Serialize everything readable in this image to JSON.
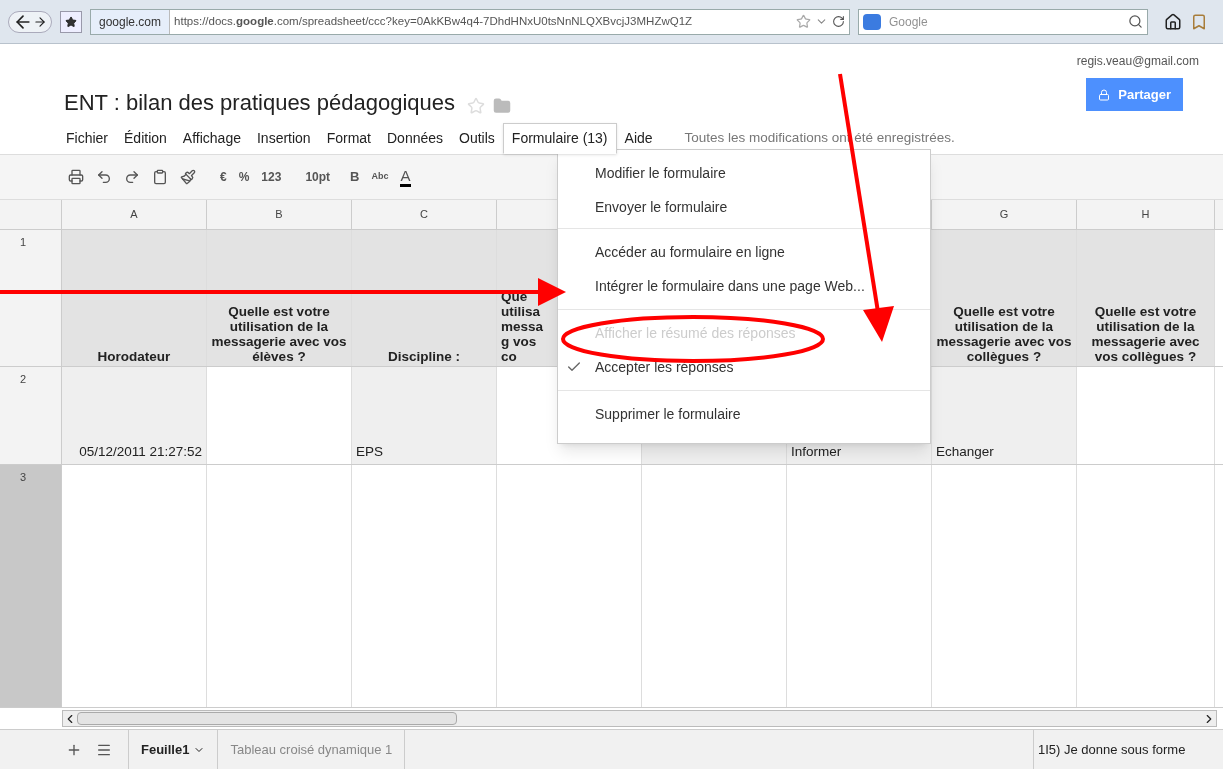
{
  "browser": {
    "site_badge": "google.com",
    "url": "https://docs.**google**.com/spreadsheet/ccc?key=0AkKBw4q4-7DhdHNxU0tsNnNLQXBvcjJ3MHZwQ1Z",
    "search": {
      "placeholder": "Google"
    }
  },
  "account": "regis.veau@gmail.com",
  "share_button": "Partager",
  "title": "ENT : bilan des pratiques pédagogiques",
  "menu": [
    {
      "label": "Fichier",
      "selected": false
    },
    {
      "label": "Édition",
      "selected": false
    },
    {
      "label": "Affichage",
      "selected": false
    },
    {
      "label": "Insertion",
      "selected": false
    },
    {
      "label": "Format",
      "selected": false
    },
    {
      "label": "Données",
      "selected": false
    },
    {
      "label": "Outils",
      "selected": false
    },
    {
      "label": "Formulaire (13)",
      "selected": true
    },
    {
      "label": "Aide",
      "selected": false
    }
  ],
  "save_status": "Toutes les modifications ont été enregistrées.",
  "toolbar": {
    "currency": "€",
    "percent": "%",
    "number_format": "123",
    "font_size": "10pt",
    "bold": "B",
    "spellcheck": "Abc",
    "text_color": "A"
  },
  "dropdown": [
    [
      {
        "label": "Modifier le formulaire",
        "disabled": false,
        "checked": false
      },
      {
        "label": "Envoyer le formulaire",
        "disabled": false,
        "checked": false
      }
    ],
    [
      {
        "label": "Accéder au formulaire en ligne",
        "disabled": false,
        "checked": false
      },
      {
        "label": "Intégrer le formulaire dans une page Web...",
        "disabled": false,
        "checked": false
      }
    ],
    [
      {
        "label": "Afficher le résumé des réponses",
        "disabled": true,
        "checked": false
      },
      {
        "label": "Accepter les réponses",
        "disabled": false,
        "checked": true
      }
    ],
    [
      {
        "label": "Supprimer le formulaire",
        "disabled": false,
        "checked": false
      }
    ]
  ],
  "grid": {
    "columns": [
      "A",
      "B",
      "C",
      "",
      "",
      "",
      "G",
      "H"
    ],
    "rows": [
      {
        "number": "1",
        "cells": [
          "Horodateur",
          "Quelle est votre utilisation de la messagerie avec vos élèves ?",
          "Discipline :",
          "Que utilisa messag vos co",
          "",
          "",
          "Quelle est votre utilisation de la messagerie avec vos collègues ?",
          "Quelle est votre utilisation de la messagerie avec vos collègues ?"
        ]
      },
      {
        "number": "2",
        "cells": [
          "05/12/2011 21:27:52",
          "",
          "EPS",
          "",
          "",
          "Informer",
          "Echanger",
          ""
        ]
      },
      {
        "number": "3",
        "cells": [
          "",
          "",
          "",
          "",
          "",
          "",
          "",
          ""
        ]
      }
    ]
  },
  "sheets": [
    {
      "label": "Feuille1",
      "selected": true
    },
    {
      "label": "Tableau croisé dynamique 1",
      "selected": false
    }
  ],
  "cell_preview": "1I5) Je donne sous forme"
}
